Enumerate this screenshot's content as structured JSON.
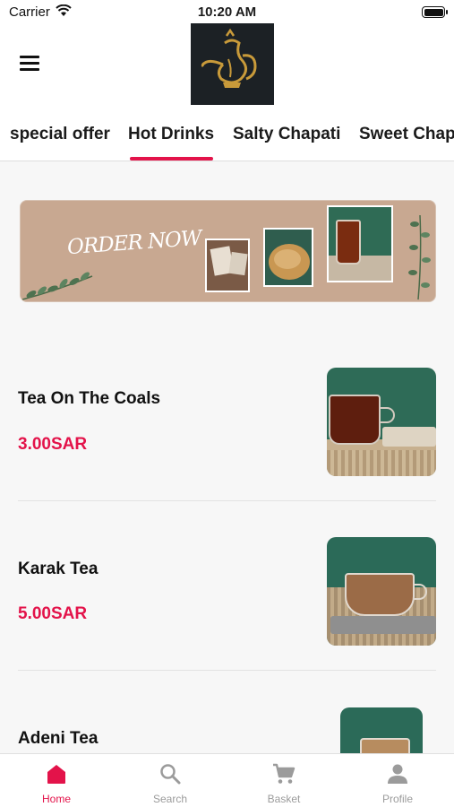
{
  "status_bar": {
    "carrier": "Carrier",
    "time": "10:20 AM"
  },
  "header": {
    "menu_icon": "hamburger-menu-icon",
    "logo": "dallah-coffee-pot-logo"
  },
  "tabs": [
    {
      "label": "special offer",
      "active": false
    },
    {
      "label": "Hot Drinks",
      "active": true
    },
    {
      "label": "Salty Chapati",
      "active": false
    },
    {
      "label": "Sweet Chap",
      "active": false
    }
  ],
  "banner": {
    "text": "ORDER NOW"
  },
  "products": [
    {
      "name": "Tea On The Coals",
      "price": "3.00SAR"
    },
    {
      "name": "Karak Tea",
      "price": "5.00SAR"
    },
    {
      "name": "Adeni Tea",
      "price": ""
    }
  ],
  "bottom_nav": [
    {
      "label": "Home",
      "icon": "home-icon",
      "active": true
    },
    {
      "label": "Search",
      "icon": "search-icon",
      "active": false
    },
    {
      "label": "Basket",
      "icon": "cart-icon",
      "active": false
    },
    {
      "label": "Profile",
      "icon": "profile-icon",
      "active": false
    }
  ],
  "colors": {
    "accent": "#e3134a",
    "inactive": "#9b9b9b",
    "banner_bg": "#c8a891",
    "logo_bg": "#1c2125",
    "logo_gold": "#c89a3a"
  }
}
